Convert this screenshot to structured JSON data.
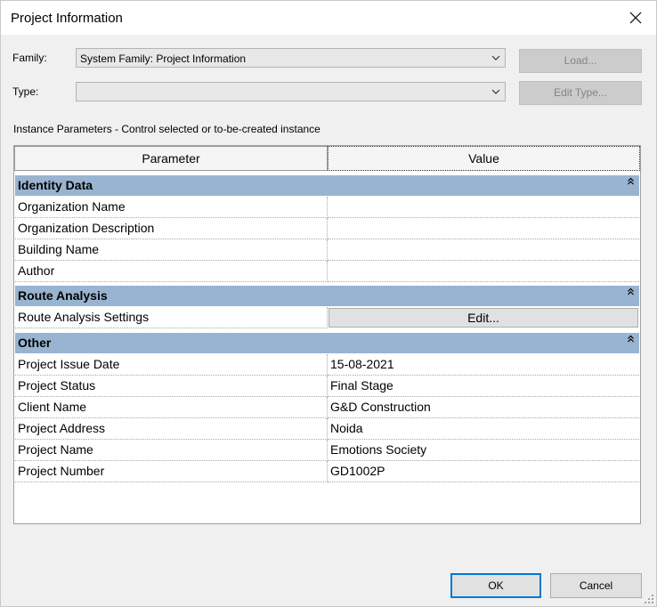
{
  "dialog": {
    "title": "Project Information"
  },
  "family": {
    "label": "Family:",
    "value": "System Family: Project Information",
    "load_button": "Load..."
  },
  "type": {
    "label": "Type:",
    "value": "",
    "edit_type_button": "Edit Type..."
  },
  "instance_parameters_caption": "Instance Parameters - Control selected or to-be-created instance",
  "grid": {
    "header_parameter": "Parameter",
    "header_value": "Value",
    "groups": [
      {
        "name": "Identity Data",
        "rows": [
          {
            "parameter": "Organization Name",
            "value": ""
          },
          {
            "parameter": "Organization Description",
            "value": ""
          },
          {
            "parameter": "Building Name",
            "value": ""
          },
          {
            "parameter": "Author",
            "value": ""
          }
        ]
      },
      {
        "name": "Route Analysis",
        "rows": [
          {
            "parameter": "Route Analysis Settings",
            "value": "Edit..."
          }
        ]
      },
      {
        "name": "Other",
        "rows": [
          {
            "parameter": "Project Issue Date",
            "value": "15-08-2021"
          },
          {
            "parameter": "Project Status",
            "value": "Final Stage"
          },
          {
            "parameter": "Client Name",
            "value": "G&D Construction"
          },
          {
            "parameter": "Project Address",
            "value": "Noida"
          },
          {
            "parameter": "Project Name",
            "value": "Emotions Society"
          },
          {
            "parameter": "Project Number",
            "value": "GD1002P"
          }
        ]
      }
    ]
  },
  "footer": {
    "ok_label": "OK",
    "cancel_label": "Cancel"
  },
  "colors": {
    "group_header": "#99b4d1",
    "dialog_bg": "#f0f0f0",
    "primary_border": "#0078d7"
  },
  "icons": {
    "close": "close-icon",
    "dropdown": "chevron-down-icon",
    "collapse": "collapse-group-icon",
    "grip": "resize-grip-icon"
  }
}
